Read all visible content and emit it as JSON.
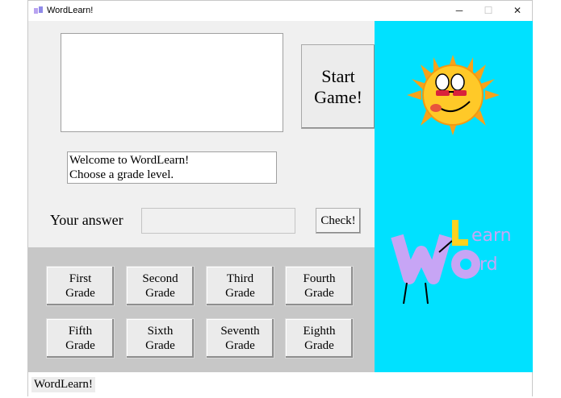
{
  "window": {
    "title": "WordLearn!",
    "controls": {
      "minimize": "─",
      "maximize": "☐",
      "close": "✕"
    }
  },
  "main": {
    "start_button": {
      "line1": "Start",
      "line2": "Game!"
    },
    "message": {
      "line1": "Welcome to WordLearn!",
      "line2": "Choose a grade level."
    },
    "answer_label": "Your answer",
    "answer_value": "",
    "check_button": "Check!"
  },
  "grades": [
    {
      "line1": "First",
      "line2": "Grade"
    },
    {
      "line1": "Second",
      "line2": "Grade"
    },
    {
      "line1": "Third",
      "line2": "Grade"
    },
    {
      "line1": "Fourth",
      "line2": "Grade"
    },
    {
      "line1": "Fifth",
      "line2": "Grade"
    },
    {
      "line1": "Sixth",
      "line2": "Grade"
    },
    {
      "line1": "Seventh",
      "line2": "Grade"
    },
    {
      "line1": "Eighth",
      "line2": "Grade"
    }
  ],
  "status": "WordLearn!",
  "colors": {
    "right_panel": "#00e1ff",
    "grade_panel": "#c7c7c7",
    "left_panel": "#f0f0f0"
  },
  "icons": [
    "app-icon",
    "sun-mascot-icon",
    "wordlearn-logo-icon"
  ]
}
